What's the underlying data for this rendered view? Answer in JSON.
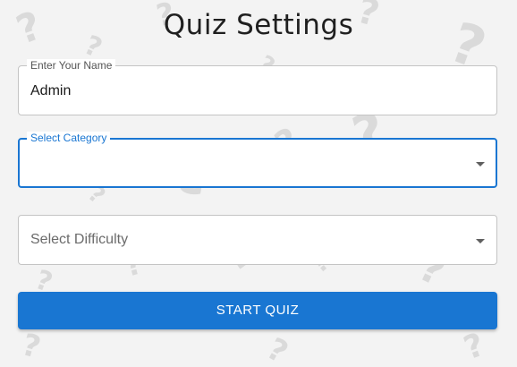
{
  "title": "Quiz Settings",
  "name_field": {
    "label": "Enter Your Name",
    "value": "Admin"
  },
  "category_field": {
    "label": "Select Category",
    "value": "",
    "dropdown_icon": "arrow-drop-down-icon"
  },
  "difficulty_field": {
    "placeholder": "Select Difficulty",
    "dropdown_icon": "arrow-drop-down-icon"
  },
  "start_button": {
    "label": "START QUIZ"
  },
  "colors": {
    "accent": "#1976d2",
    "background": "#f3f3f3",
    "pattern": "#dadada"
  }
}
